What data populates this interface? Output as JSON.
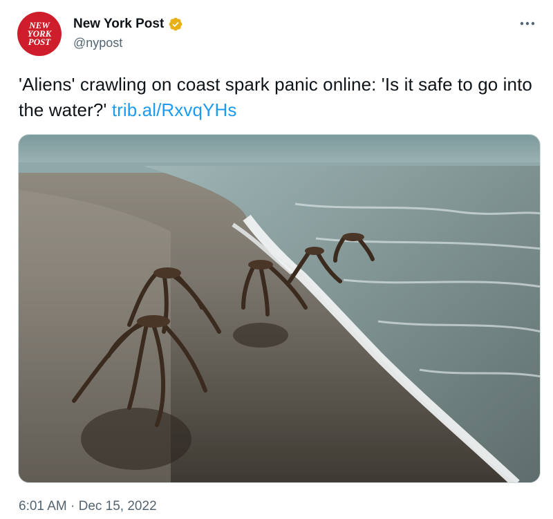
{
  "author": {
    "display_name": "New York Post",
    "handle": "@nypost",
    "verified": true,
    "avatar_lines": [
      "NEW",
      "YORK",
      "POST"
    ],
    "avatar_color": "#cf1e2b",
    "verified_color": "#e8b014"
  },
  "tweet": {
    "text": "'Aliens' crawling on coast spark panic online: 'Is it safe to go into the water?'",
    "link": "trib.al/RxvqYHs",
    "link_color": "#1d9bf0"
  },
  "meta": {
    "time": "6:01 AM",
    "separator": "·",
    "date": "Dec 15, 2022"
  },
  "icons": {
    "more": "more-dots-icon",
    "verified": "verified-badge-icon"
  }
}
